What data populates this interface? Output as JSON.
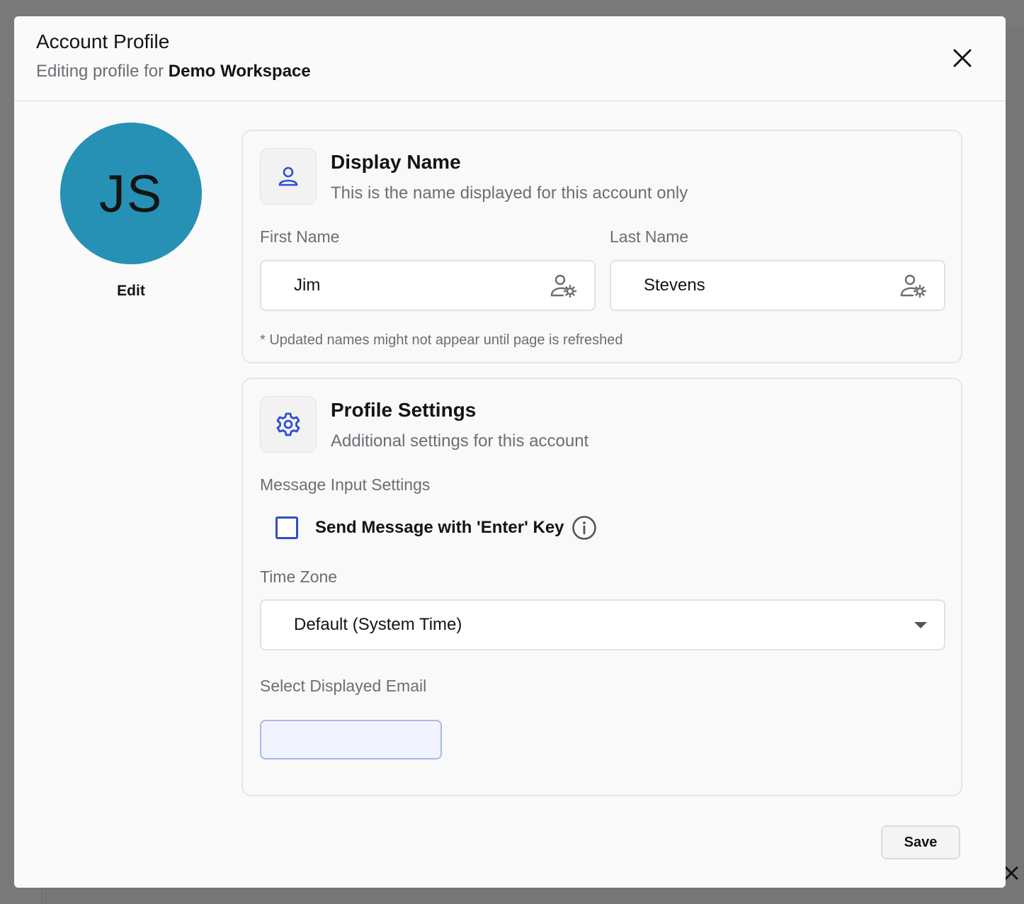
{
  "modal": {
    "title": "Account Profile",
    "subtitle_prefix": "Editing profile for",
    "workspace_name": "Demo Workspace"
  },
  "avatar": {
    "initials": "JS",
    "color": "#2790b5",
    "edit_label": "Edit"
  },
  "display_name": {
    "title": "Display Name",
    "description": "This is the name displayed for this account only",
    "icon": "user-icon",
    "first_name_label": "First Name",
    "first_name_value": "Jim",
    "last_name_label": "Last Name",
    "last_name_value": "Stevens",
    "field_icon": "user-gear-icon",
    "note": "* Updated names might not appear until page is refreshed"
  },
  "profile_settings": {
    "title": "Profile Settings",
    "description": "Additional settings for this account",
    "icon": "gear-icon",
    "message_input_label": "Message Input Settings",
    "send_enter_label": "Send Message with 'Enter' Key",
    "send_enter_checked": false,
    "time_zone_label": "Time Zone",
    "time_zone_value": "Default (System Time)",
    "email_label": "Select Displayed Email",
    "email_value": ""
  },
  "footer": {
    "save_label": "Save"
  },
  "colors": {
    "accent": "#2f4fc9",
    "avatar": "#2790b5"
  }
}
